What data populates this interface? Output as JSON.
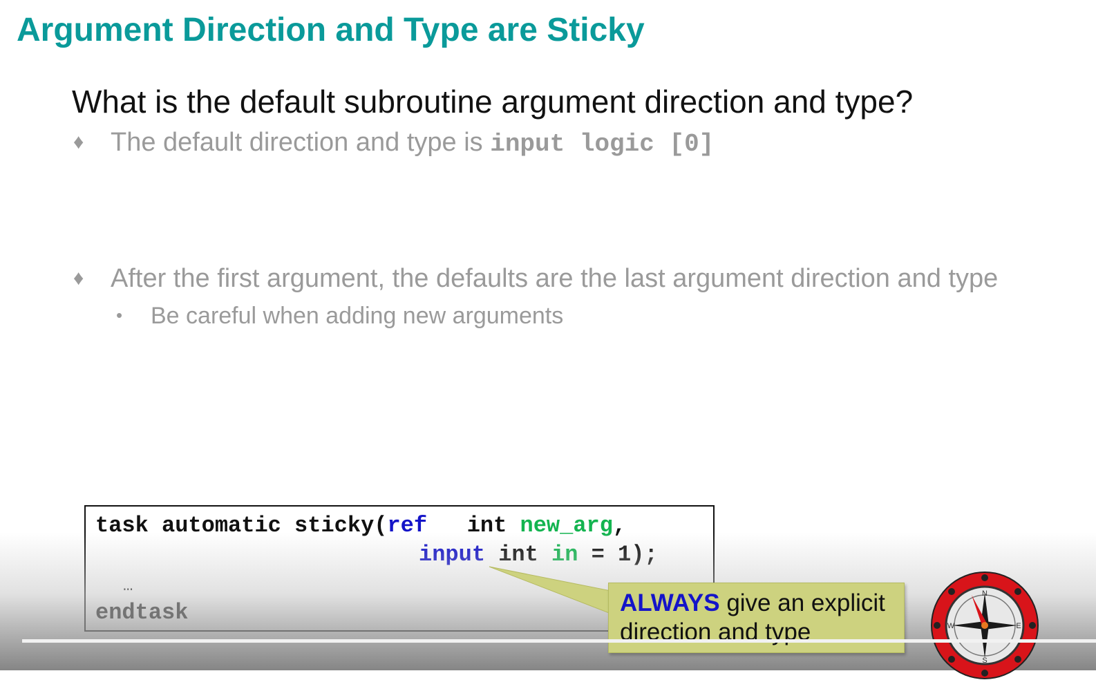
{
  "slide": {
    "title": "Argument Direction and Type are Sticky",
    "question": "What is the default subroutine argument direction and type?",
    "bullets": [
      {
        "marker": "♦",
        "text": "The default direction and type is ",
        "code": "input logic [0]"
      },
      {
        "marker": "♦",
        "text": "After the first argument, the defaults are the last argument direction and type",
        "sub": {
          "marker": "•",
          "text": "Be careful when adding new arguments"
        }
      }
    ]
  },
  "code": {
    "line1": {
      "prefix": "task automatic sticky(",
      "dir": "ref",
      "gap": "   ",
      "type": "int ",
      "name": "new_arg",
      "suffix": ","
    },
    "line2": {
      "dir": "input",
      "type": " int ",
      "name": "in",
      "suffix": " = 1);"
    },
    "line3": "…",
    "line4": "endtask"
  },
  "callout": {
    "strong": "ALWAYS",
    "line1_rest": " give an explicit",
    "line2": "direction and type"
  },
  "colors": {
    "title": "#0a9a9a",
    "keyword": "#1414c8",
    "identifier": "#14b450",
    "callout_bg": "#cdd27f"
  },
  "icons": {
    "logo": "compass-icon",
    "compass_labels": [
      "N",
      "W",
      "E",
      "S"
    ]
  }
}
